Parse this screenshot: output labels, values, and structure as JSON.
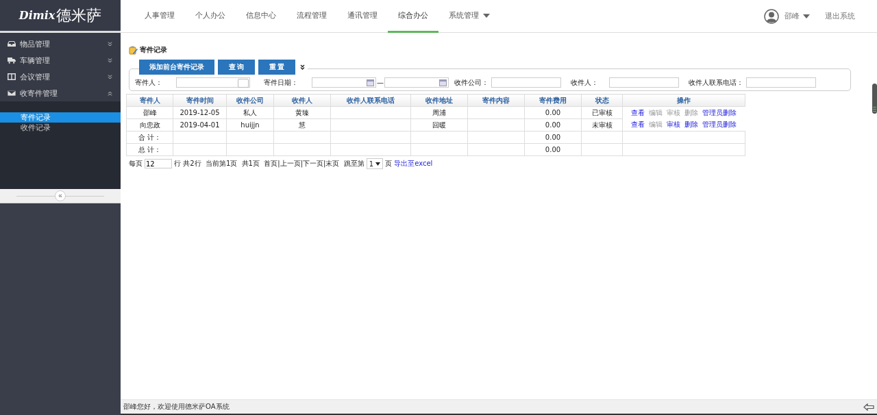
{
  "logo": {
    "latin": "Dimix",
    "name": "德米萨"
  },
  "nav": [
    {
      "label": "人事管理",
      "selected": false,
      "has_menu": false
    },
    {
      "label": "个人办公",
      "selected": false,
      "has_menu": false
    },
    {
      "label": "信息中心",
      "selected": false,
      "has_menu": false
    },
    {
      "label": "流程管理",
      "selected": false,
      "has_menu": false
    },
    {
      "label": "通讯管理",
      "selected": false,
      "has_menu": false
    },
    {
      "label": "综合办公",
      "selected": true,
      "has_menu": false
    },
    {
      "label": "系统管理",
      "selected": false,
      "has_menu": true
    }
  ],
  "user": {
    "name": "邵峰",
    "logout": "退出系统"
  },
  "sidebar": {
    "items": [
      {
        "label": "物品管理",
        "expanded": false
      },
      {
        "label": "车辆管理",
        "expanded": false
      },
      {
        "label": "会议管理",
        "expanded": false
      },
      {
        "label": "收寄件管理",
        "expanded": true,
        "children": [
          {
            "label": "寄件记录",
            "selected": true
          },
          {
            "label": "收件记录",
            "selected": false
          }
        ]
      }
    ],
    "collapse": "«"
  },
  "page_title": "寄件记录",
  "buttons": [
    "添加前台寄件记录",
    "查 询",
    "重 置"
  ],
  "filters": [
    {
      "label": "寄件人：",
      "kind": "picker"
    },
    {
      "label": "寄件日期：",
      "kind": "daterange",
      "separator": "—"
    },
    {
      "label": "收件公司：",
      "kind": "text"
    },
    {
      "label": "收件人：",
      "kind": "text"
    },
    {
      "label": "收件人联系电话：",
      "kind": "text"
    }
  ],
  "table": {
    "columns": [
      "寄件人",
      "寄件时间",
      "收件公司",
      "收件人",
      "收件人联系电话",
      "收件地址",
      "寄件内容",
      "寄件费用",
      "状态",
      "操作"
    ],
    "rows": [
      {
        "cells": [
          "邵峰",
          "2019-12-05",
          "私人",
          "黄臻",
          "",
          "周浦",
          "",
          "0.00",
          "已审核"
        ],
        "actions": [
          {
            "label": "查看",
            "disabled": false
          },
          {
            "label": "编辑",
            "disabled": true
          },
          {
            "label": "审核",
            "disabled": true
          },
          {
            "label": "删除",
            "disabled": true
          },
          {
            "label": "管理员删除",
            "disabled": false
          }
        ]
      },
      {
        "cells": [
          "向忠政",
          "2019-04-01",
          "huijjn",
          "慧",
          "",
          "回暖",
          "",
          "0.00",
          "未审核"
        ],
        "actions": [
          {
            "label": "查看",
            "disabled": false
          },
          {
            "label": "编辑",
            "disabled": true
          },
          {
            "label": "审核",
            "disabled": false
          },
          {
            "label": "删除",
            "disabled": false
          },
          {
            "label": "管理员删除",
            "disabled": false
          }
        ]
      }
    ],
    "totals": [
      {
        "label": "合 计：",
        "fee": "0.00"
      },
      {
        "label": "总 计：",
        "fee": "0.00"
      }
    ]
  },
  "pager": {
    "per_page_label": "每页",
    "per_page": "12",
    "info": "行 共2行  当前第1页  共1页  首页|上一页|下一页|末页  跳至第",
    "page": "1",
    "page_suffix": "页",
    "export": "导出至excel"
  },
  "status_bar": "邵峰您好，欢迎使用德米萨OA系统"
}
